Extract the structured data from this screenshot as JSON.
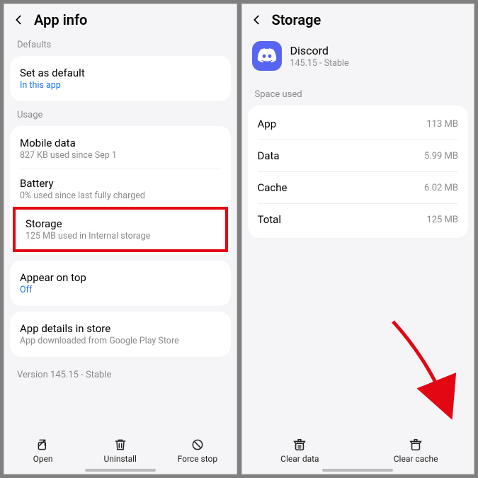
{
  "left": {
    "title": "App info",
    "defaults_label": "Defaults",
    "set_default": {
      "title": "Set as default",
      "sub": "In this app"
    },
    "usage_label": "Usage",
    "mobile_data": {
      "title": "Mobile data",
      "sub": "827 KB used since Sep 1"
    },
    "battery": {
      "title": "Battery",
      "sub": "0% used since last fully charged"
    },
    "storage": {
      "title": "Storage",
      "sub": "125 MB used in Internal storage"
    },
    "appear_on_top": {
      "title": "Appear on top",
      "sub": "Off"
    },
    "app_details": {
      "title": "App details in store",
      "sub": "App downloaded from Google Play Store"
    },
    "version": "Version 145.15 - Stable",
    "open": "Open",
    "uninstall": "Uninstall",
    "force_stop": "Force stop"
  },
  "right": {
    "title": "Storage",
    "app_name": "Discord",
    "app_version": "145.15 - Stable",
    "space_used_label": "Space used",
    "rows": {
      "app": {
        "label": "App",
        "value": "113 MB"
      },
      "data": {
        "label": "Data",
        "value": "5.99 MB"
      },
      "cache": {
        "label": "Cache",
        "value": "6.02 MB"
      },
      "total": {
        "label": "Total",
        "value": "125 MB"
      }
    },
    "clear_data": "Clear data",
    "clear_cache": "Clear cache"
  }
}
